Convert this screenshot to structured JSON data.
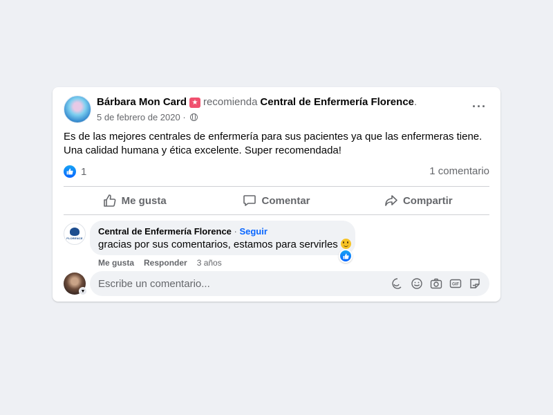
{
  "post": {
    "author": "Bárbara Mon Card",
    "verb": "recomienda",
    "page": "Central de Enfermería Florence",
    "punct": ".",
    "date": "5 de febrero de 2020 ·",
    "text": "Es de las mejores centrales de enfermería para sus pacientes ya que las enfermeras tiene. Una calidad humana y ética excelente. Super recomendada!",
    "likes": "1",
    "comments_count": "1 comentario",
    "more": "···"
  },
  "actions": {
    "like": "Me gusta",
    "comment": "Comentar",
    "share": "Compartir"
  },
  "comment": {
    "author": "Central de Enfermería Florence",
    "sep": " · ",
    "follow": "Seguir",
    "text": "gracias por sus comentarios, estamos para servirles",
    "like": "Me gusta",
    "reply": "Responder",
    "age": "3 años",
    "logo_text": "FLORENCE"
  },
  "composer": {
    "placeholder": "Escribe un comentario..."
  },
  "colors": {
    "accent": "#0866ff",
    "secondary_text": "#65676b",
    "badge": "#f0506e"
  },
  "icons": [
    "like-icon",
    "comment-icon",
    "share-icon",
    "globe-icon",
    "more-icon",
    "sticker-icon",
    "emoji-icon",
    "camera-icon",
    "gif-icon",
    "avatar-sticker-icon"
  ]
}
